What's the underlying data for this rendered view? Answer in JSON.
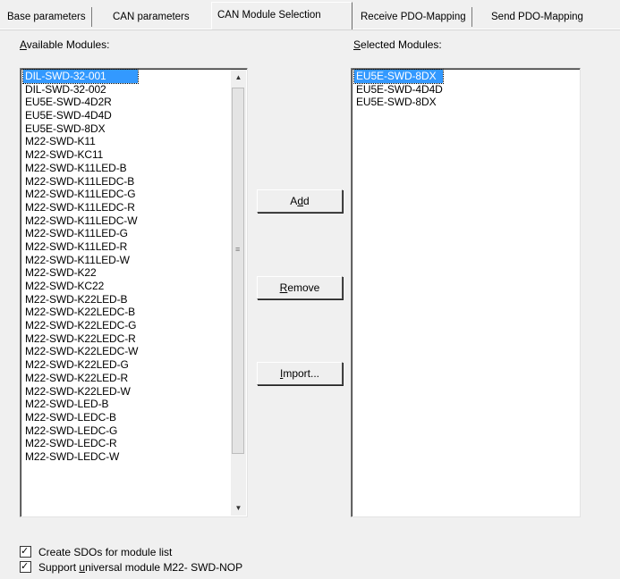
{
  "tabs": [
    {
      "label": "Base parameters",
      "active": false
    },
    {
      "label": "CAN parameters",
      "active": false
    },
    {
      "label": "CAN Module Selection",
      "active": true
    },
    {
      "label": "Receive PDO-Mapping",
      "active": false
    },
    {
      "label": "Send PDO-Mapping",
      "active": false
    }
  ],
  "available": {
    "label_pre": "",
    "label_accel": "A",
    "label_post": "vailable Modules:",
    "selected_index": 0,
    "items": [
      "DIL-SWD-32-001",
      "DIL-SWD-32-002",
      "EU5E-SWD-4D2R",
      "EU5E-SWD-4D4D",
      "EU5E-SWD-8DX",
      "M22-SWD-K11",
      "M22-SWD-KC11",
      "M22-SWD-K11LED-B",
      "M22-SWD-K11LEDC-B",
      "M22-SWD-K11LEDC-G",
      "M22-SWD-K11LEDC-R",
      "M22-SWD-K11LEDC-W",
      "M22-SWD-K11LED-G",
      "M22-SWD-K11LED-R",
      "M22-SWD-K11LED-W",
      "M22-SWD-K22",
      "M22-SWD-KC22",
      "M22-SWD-K22LED-B",
      "M22-SWD-K22LEDC-B",
      "M22-SWD-K22LEDC-G",
      "M22-SWD-K22LEDC-R",
      "M22-SWD-K22LEDC-W",
      "M22-SWD-K22LED-G",
      "M22-SWD-K22LED-R",
      "M22-SWD-K22LED-W",
      "M22-SWD-LED-B",
      "M22-SWD-LEDC-B",
      "M22-SWD-LEDC-G",
      "M22-SWD-LEDC-R",
      "M22-SWD-LEDC-W"
    ]
  },
  "selected": {
    "label_pre": "",
    "label_accel": "S",
    "label_post": "elected Modules:",
    "selected_index": 0,
    "items": [
      "EU5E-SWD-8DX",
      "EU5E-SWD-4D4D",
      "EU5E-SWD-8DX"
    ]
  },
  "buttons": {
    "add": {
      "pre": "A",
      "accel": "d",
      "post": "d"
    },
    "remove": {
      "pre": "",
      "accel": "R",
      "post": "emove"
    },
    "import": {
      "pre": "",
      "accel": "I",
      "post": "mport..."
    }
  },
  "checkboxes": {
    "create_sdos": {
      "pre": "Create SDOs for module list",
      "accel": "",
      "post": "",
      "checked": true
    },
    "support_universal": {
      "pre": "Support ",
      "accel": "u",
      "post": "niversal module M22- SWD-NOP",
      "checked": true
    }
  },
  "icons": {
    "scroll_up": "▲",
    "scroll_down": "▼",
    "checkmark": "✓"
  }
}
